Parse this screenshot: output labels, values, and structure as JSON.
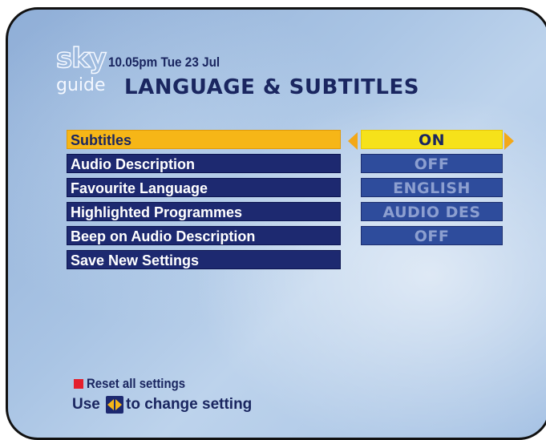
{
  "header": {
    "logo_sky": "sky",
    "logo_guide": "guide",
    "timestamp": "10.05pm Tue 23 Jul",
    "title": "LANGUAGE & SUBTITLES"
  },
  "menu": {
    "selected_index": 0,
    "items": [
      {
        "label": "Subtitles",
        "value": "ON"
      },
      {
        "label": "Audio Description",
        "value": "OFF"
      },
      {
        "label": "Favourite Language",
        "value": "ENGLISH"
      },
      {
        "label": "Highlighted Programmes",
        "value": "AUDIO DES"
      },
      {
        "label": "Beep on Audio Description",
        "value": "OFF"
      },
      {
        "label": "Save New Settings"
      }
    ]
  },
  "footer": {
    "reset_label": "Reset all settings",
    "reset_color": "#e41f2d",
    "hint_prefix": "Use",
    "hint_icon": "left-right-arrows-icon",
    "hint_suffix": "to change setting"
  },
  "colors": {
    "selected_row": "#f6b617",
    "selected_value": "#f6e21a",
    "row_background": "#1d2970",
    "value_background": "#2e4c9c",
    "text_dark": "#1a2660"
  }
}
